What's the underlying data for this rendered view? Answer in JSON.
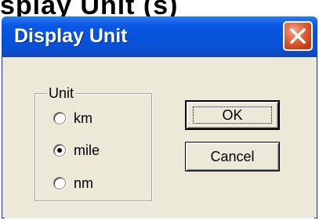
{
  "background_caption": "splay Unit (s)",
  "dialog": {
    "title": "Display Unit",
    "group": {
      "legend": "Unit",
      "options": [
        {
          "label": "km",
          "checked": false
        },
        {
          "label": "mile",
          "checked": true
        },
        {
          "label": "nm",
          "checked": false
        }
      ]
    },
    "buttons": {
      "ok": "OK",
      "cancel": "Cancel"
    }
  },
  "colors": {
    "titlebar": "#0553da",
    "close_button": "#c8401a",
    "dialog_face": "#ece9d8"
  }
}
